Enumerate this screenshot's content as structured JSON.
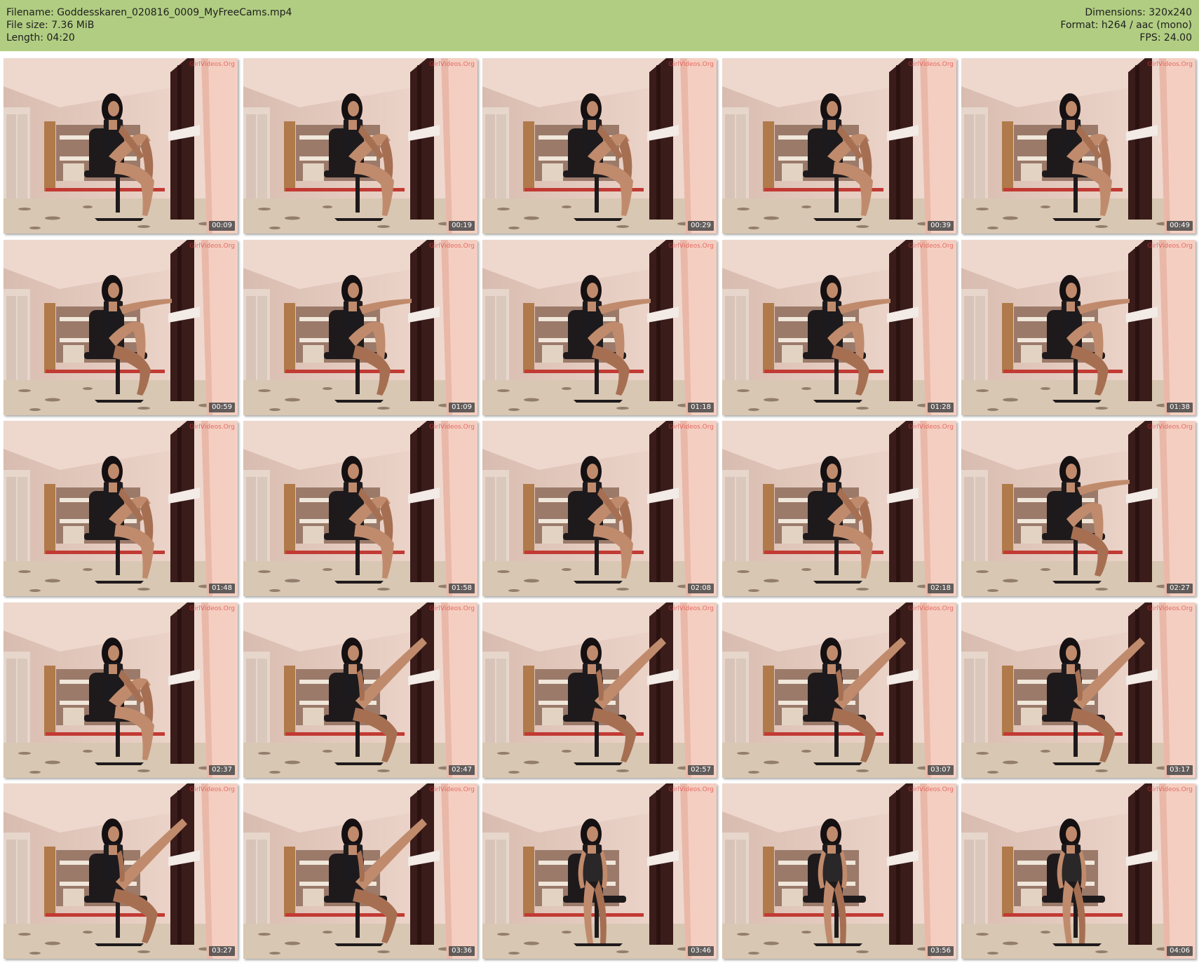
{
  "header": {
    "filename": "Filename: Goddesskaren_020816_0009_MyFreeCams.mp4",
    "file_size": "File size: 7.36 MiB",
    "length": "Length: 04:20",
    "dimensions": "Dimensions: 320x240",
    "format": "Format: h264 / aac (mono)",
    "fps": "FPS: 24.00",
    "background_color": "#b1cd82"
  },
  "watermark": "GirlVideos.Org",
  "thumbnails": [
    {
      "time": "00:09",
      "pose": "knee-up"
    },
    {
      "time": "00:19",
      "pose": "knee-up"
    },
    {
      "time": "00:29",
      "pose": "knee-up"
    },
    {
      "time": "00:39",
      "pose": "knee-up"
    },
    {
      "time": "00:49",
      "pose": "knee-up"
    },
    {
      "time": "00:59",
      "pose": "reach"
    },
    {
      "time": "01:09",
      "pose": "reach"
    },
    {
      "time": "01:18",
      "pose": "reach"
    },
    {
      "time": "01:28",
      "pose": "reach"
    },
    {
      "time": "01:38",
      "pose": "reach"
    },
    {
      "time": "01:48",
      "pose": "knee-up"
    },
    {
      "time": "01:58",
      "pose": "knee-up"
    },
    {
      "time": "02:08",
      "pose": "knee-up"
    },
    {
      "time": "02:18",
      "pose": "knee-up"
    },
    {
      "time": "02:27",
      "pose": "reach"
    },
    {
      "time": "02:37",
      "pose": "knee-up"
    },
    {
      "time": "02:47",
      "pose": "leg-raised"
    },
    {
      "time": "02:57",
      "pose": "leg-raised"
    },
    {
      "time": "03:07",
      "pose": "leg-raised"
    },
    {
      "time": "03:17",
      "pose": "leg-raised"
    },
    {
      "time": "03:27",
      "pose": "leg-raised"
    },
    {
      "time": "03:36",
      "pose": "leg-raised"
    },
    {
      "time": "03:46",
      "pose": "seated"
    },
    {
      "time": "03:56",
      "pose": "seated"
    },
    {
      "time": "04:06",
      "pose": "seated"
    }
  ]
}
